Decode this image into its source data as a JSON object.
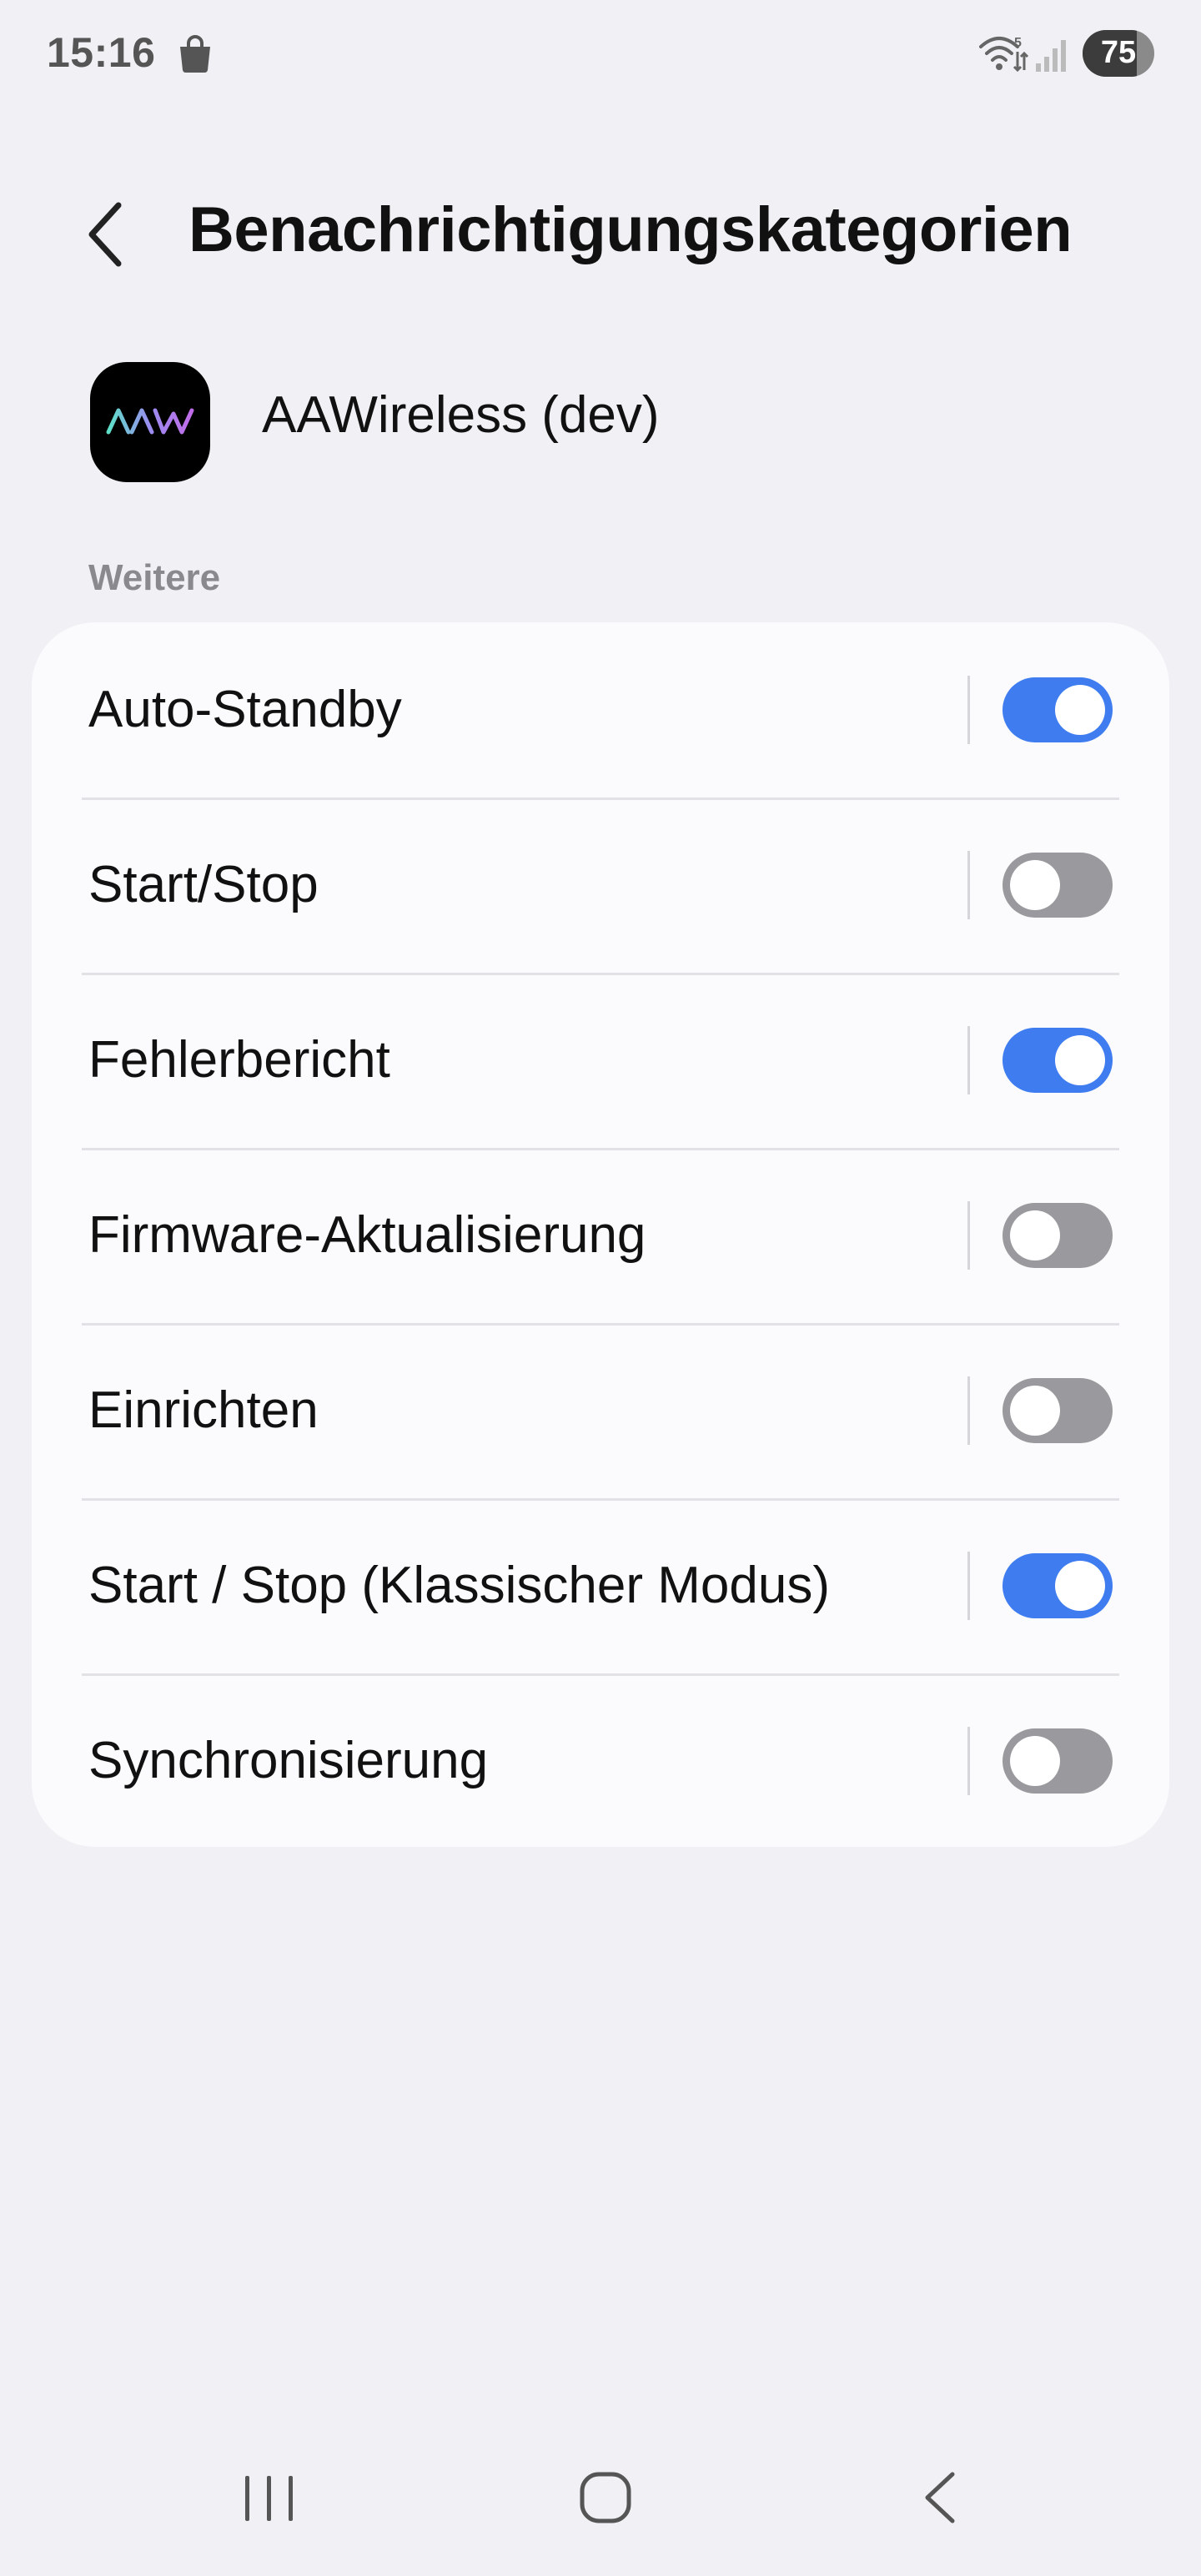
{
  "status_bar": {
    "time": "15:16",
    "battery": "75",
    "icons": [
      "shopping-bag-icon",
      "wifi-icon",
      "signal-icon",
      "battery-icon"
    ]
  },
  "header": {
    "title": "Benachrichtigungskategorien",
    "back_icon": "chevron-left-icon"
  },
  "app": {
    "name": "AAWireless (dev)",
    "icon": "aawireless-logo"
  },
  "section": {
    "label": "Weitere"
  },
  "categories": [
    {
      "label": "Auto-Standby",
      "enabled": true
    },
    {
      "label": "Start/Stop",
      "enabled": false
    },
    {
      "label": "Fehlerbericht",
      "enabled": true
    },
    {
      "label": "Firmware-Aktualisierung",
      "enabled": false
    },
    {
      "label": "Einrichten",
      "enabled": false
    },
    {
      "label": "Start / Stop (Klassischer Modus)",
      "enabled": true
    },
    {
      "label": "Synchronisierung",
      "enabled": false
    }
  ],
  "colors": {
    "background": "#f0f0f5",
    "card": "#fbfbfd",
    "toggle_on": "#3e7cf0",
    "toggle_off": "#9a9a9e"
  },
  "nav_bar": {
    "icons": [
      "recents-icon",
      "home-icon",
      "back-icon"
    ]
  }
}
